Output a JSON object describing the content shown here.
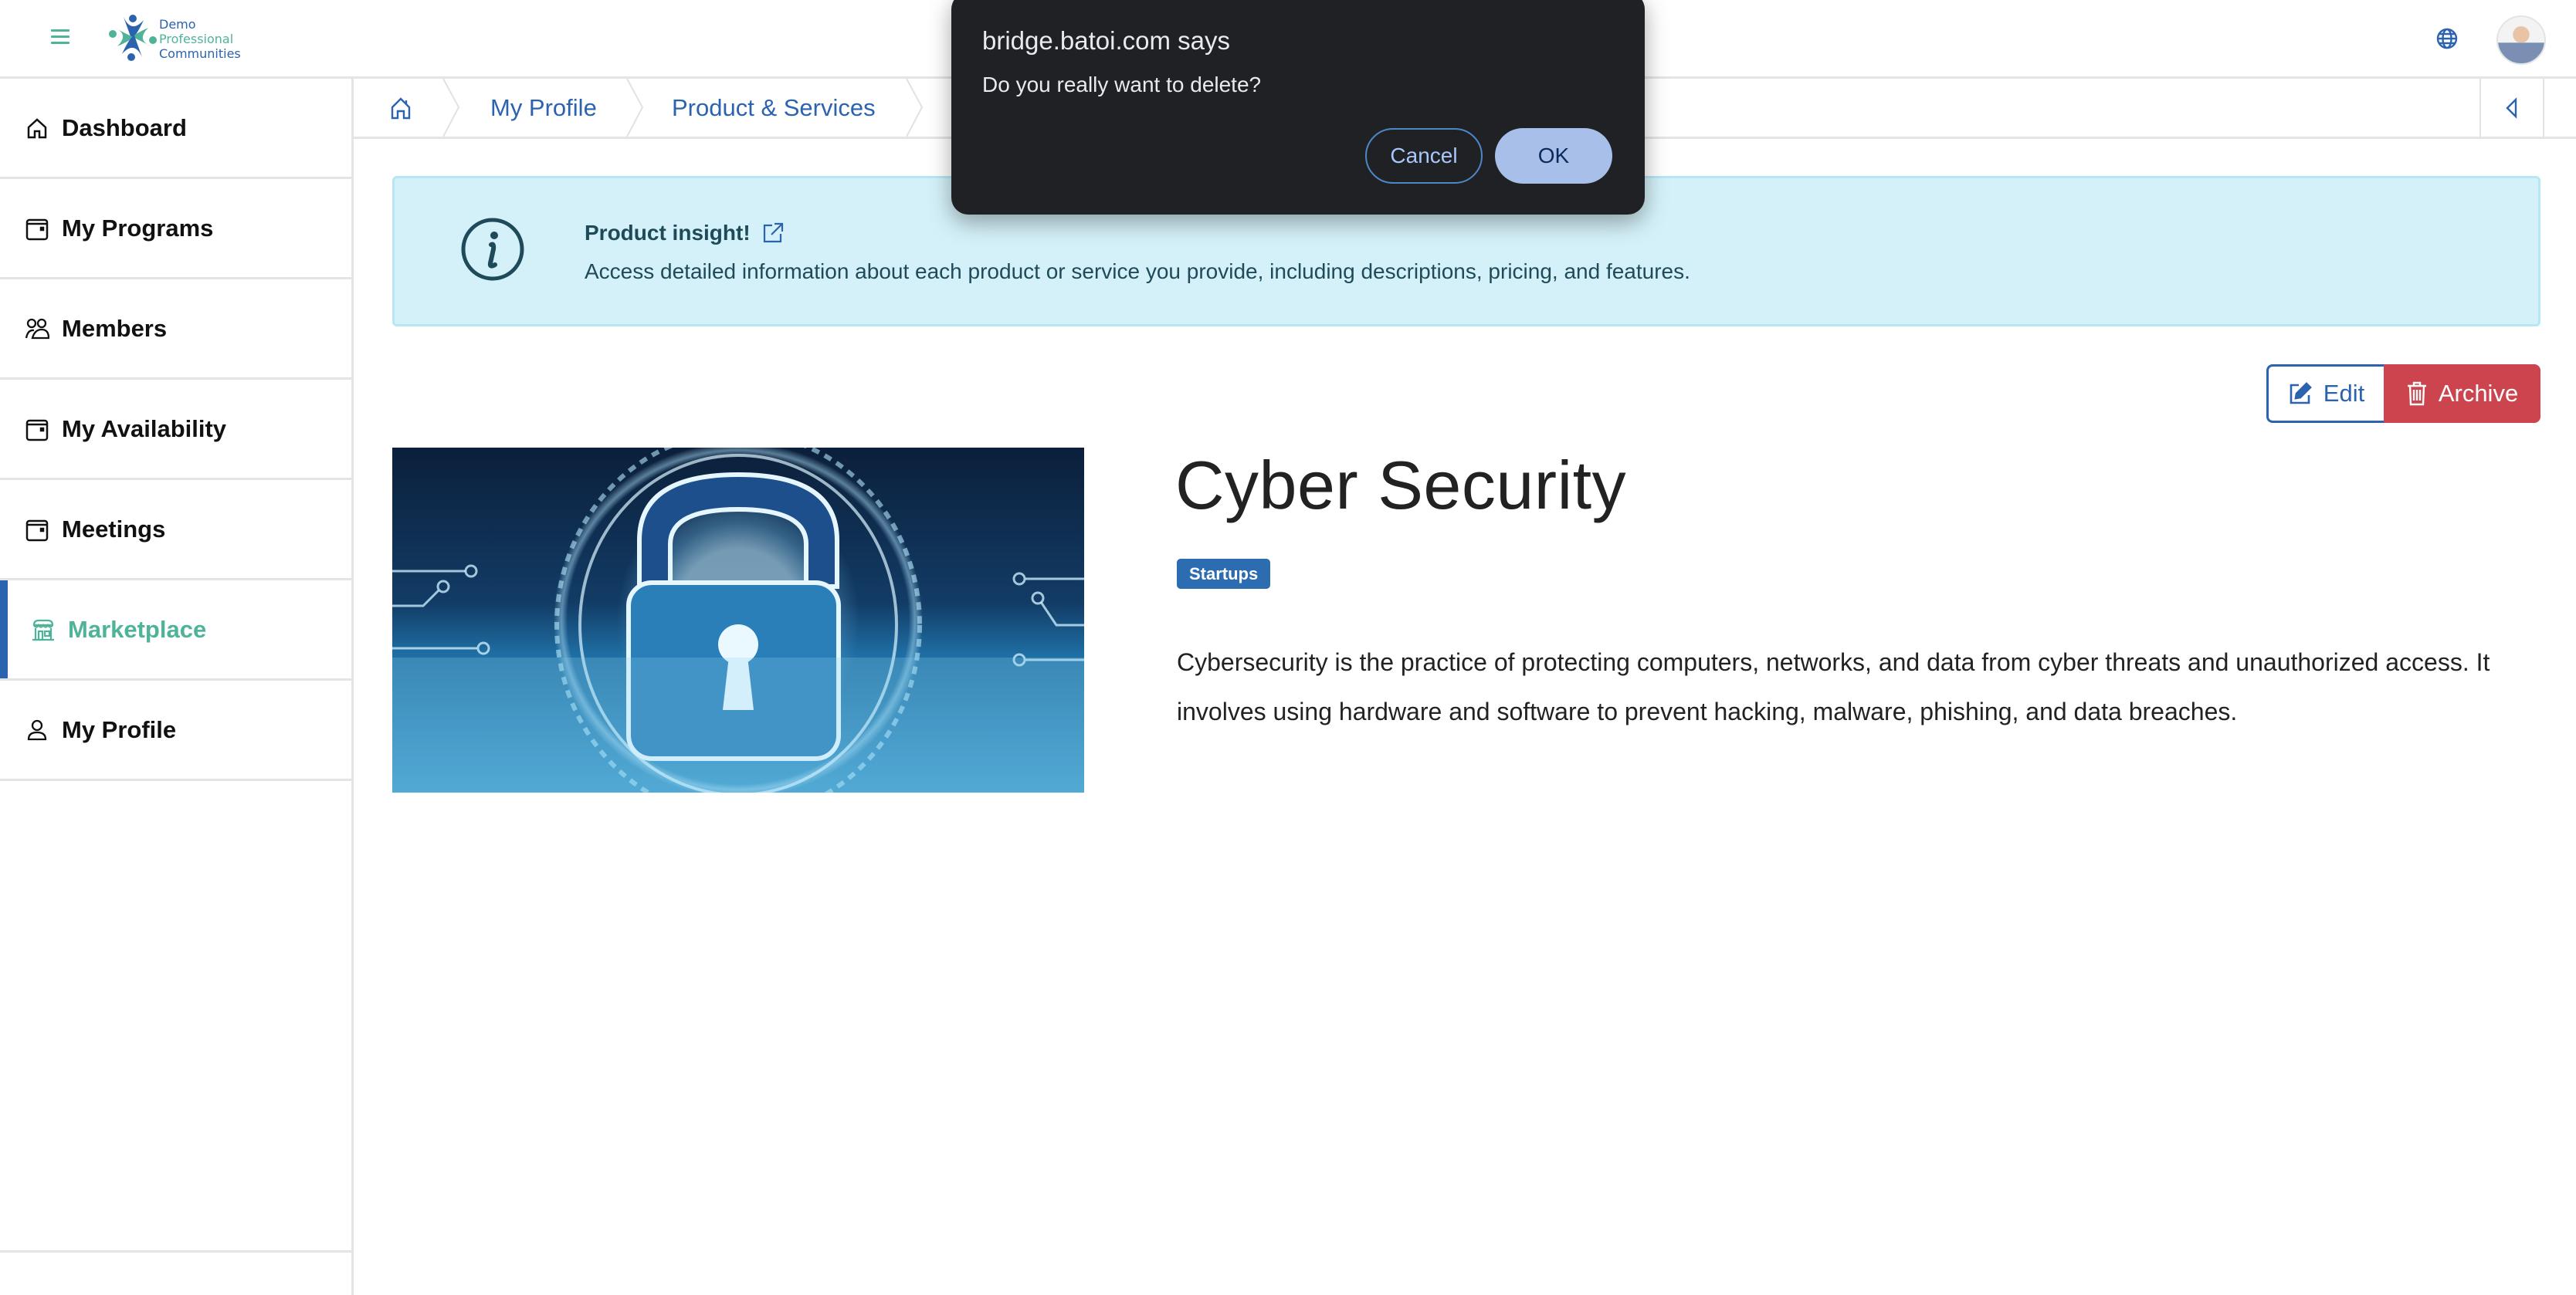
{
  "header": {
    "menu_icon": "hamburger-icon",
    "logo": {
      "line1": "Demo",
      "line2": "Professional",
      "line3": "Communities"
    },
    "language_icon": "globe-icon",
    "avatar_icon": "user-avatar"
  },
  "sidebar": {
    "items": [
      {
        "label": "Dashboard",
        "icon": "home-icon",
        "active": false
      },
      {
        "label": "My Programs",
        "icon": "calendar-icon",
        "active": false
      },
      {
        "label": "Members",
        "icon": "users-icon",
        "active": false
      },
      {
        "label": "My Availability",
        "icon": "calendar-icon",
        "active": false
      },
      {
        "label": "Meetings",
        "icon": "calendar-icon",
        "active": false
      },
      {
        "label": "Marketplace",
        "icon": "store-icon",
        "active": true
      },
      {
        "label": "My Profile",
        "icon": "user-icon",
        "active": false
      }
    ]
  },
  "breadcrumb": {
    "home_icon": "home-icon",
    "items": [
      "My Profile",
      "Product & Services"
    ],
    "collapse_icon": "triangle-left-icon"
  },
  "alert": {
    "title": "Product insight!",
    "body": "Access detailed information about each product or service you provide, including descriptions, pricing, and features."
  },
  "actions": {
    "edit_label": "Edit",
    "archive_label": "Archive"
  },
  "product": {
    "title": "Cyber Security",
    "badge": "Startups",
    "description": "Cybersecurity is the practice of protecting computers, networks, and data from cyber threats and unauthorized access. It involves using hardware and software to prevent hacking, malware, phishing, and data breaches.",
    "image_alt": "Padlock with binary code cyber security illustration"
  },
  "dialog": {
    "title": "bridge.batoi.com says",
    "message": "Do you really want to delete?",
    "cancel_label": "Cancel",
    "ok_label": "OK"
  },
  "colors": {
    "brand_blue": "#2c63ae",
    "brand_green": "#4fb39a",
    "danger": "#cc444d",
    "alert_bg": "#d4f1f9",
    "dialog_bg": "#202124"
  }
}
